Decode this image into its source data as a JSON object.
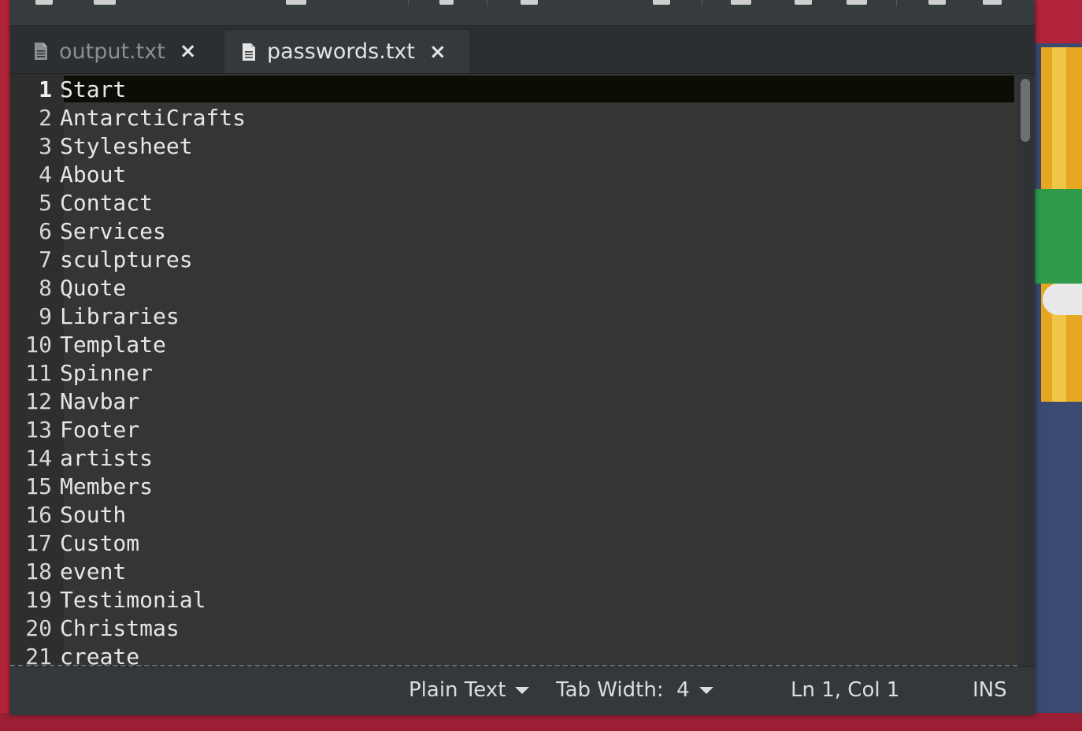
{
  "tabs": [
    {
      "label": "output.txt",
      "close": "×",
      "active": false
    },
    {
      "label": "passwords.txt",
      "close": "×",
      "active": true
    }
  ],
  "editor": {
    "lines": [
      {
        "num": "1",
        "text": "Start"
      },
      {
        "num": "2",
        "text": "AntarctiCrafts"
      },
      {
        "num": "3",
        "text": "Stylesheet"
      },
      {
        "num": "4",
        "text": "About"
      },
      {
        "num": "5",
        "text": "Contact"
      },
      {
        "num": "6",
        "text": "Services"
      },
      {
        "num": "7",
        "text": "sculptures"
      },
      {
        "num": "8",
        "text": "Quote"
      },
      {
        "num": "9",
        "text": "Libraries"
      },
      {
        "num": "10",
        "text": "Template"
      },
      {
        "num": "11",
        "text": "Spinner"
      },
      {
        "num": "12",
        "text": "Navbar"
      },
      {
        "num": "13",
        "text": "Footer"
      },
      {
        "num": "14",
        "text": "artists"
      },
      {
        "num": "15",
        "text": "Members"
      },
      {
        "num": "16",
        "text": "South"
      },
      {
        "num": "17",
        "text": "Custom"
      },
      {
        "num": "18",
        "text": "event"
      },
      {
        "num": "19",
        "text": "Testimonial"
      },
      {
        "num": "20",
        "text": "Christmas"
      },
      {
        "num": "21",
        "text": "create"
      }
    ]
  },
  "statusbar": {
    "language": "Plain Text",
    "tab_width": "Tab Width:  4",
    "cursor": "Ln 1, Col 1",
    "mode": "INS"
  },
  "icons": {
    "tab_file": "text-file-icon",
    "dropdown": "dropdown-caret-icon"
  }
}
